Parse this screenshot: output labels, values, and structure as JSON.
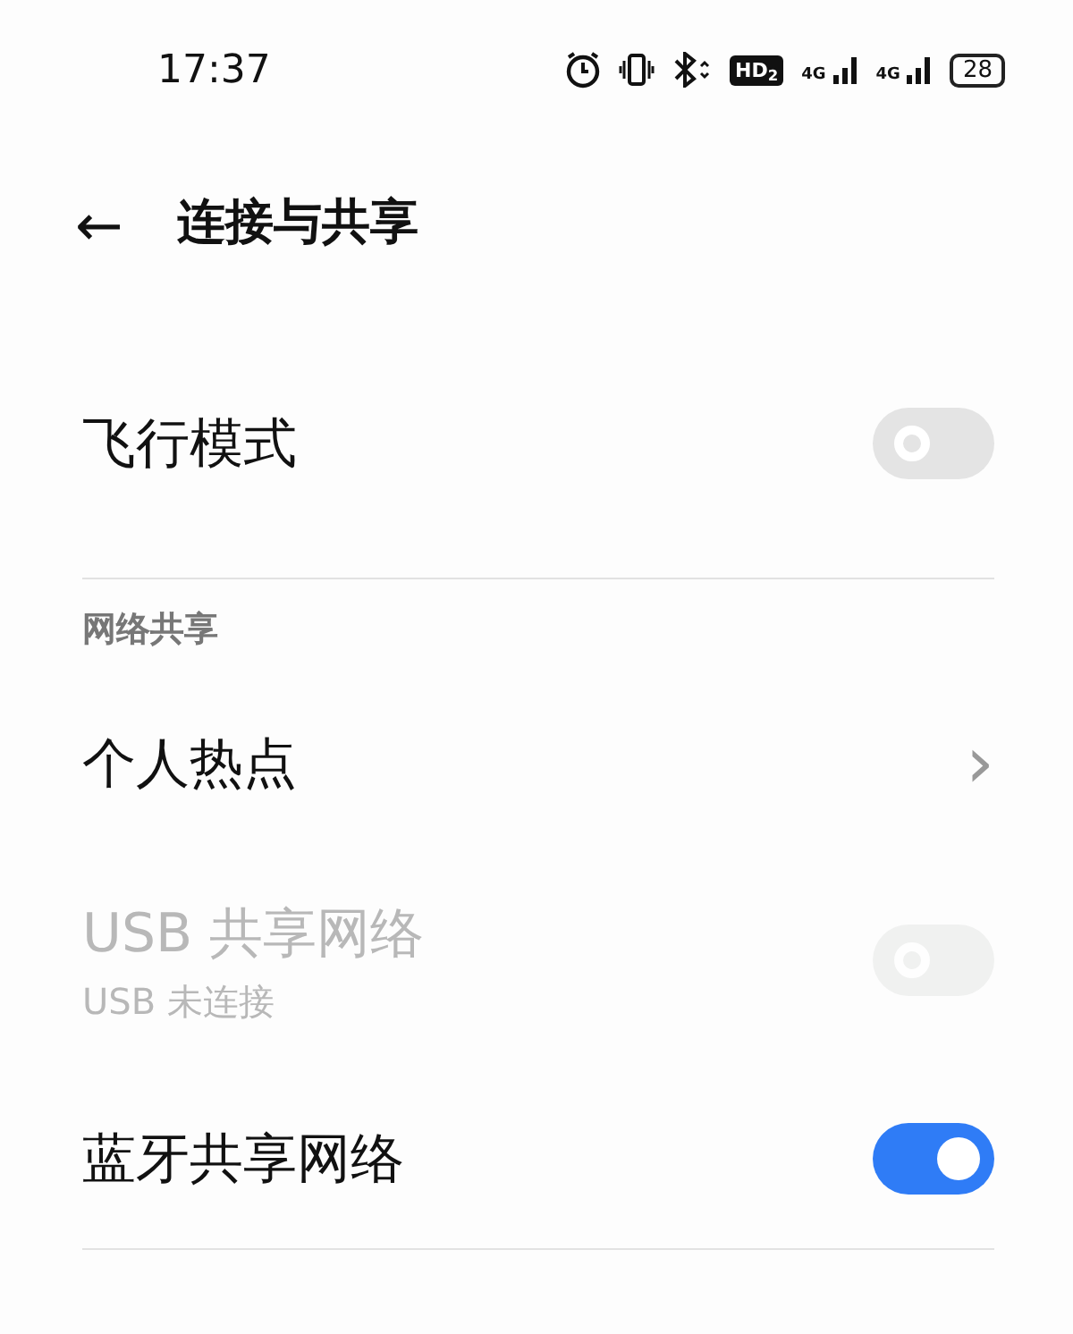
{
  "status_bar": {
    "time": "17:37",
    "hd_badge": "HD$_{2}$",
    "signals": [
      {
        "label": "4G"
      },
      {
        "label": "4G"
      }
    ],
    "battery": "28"
  },
  "header": {
    "back": "←",
    "title": "连接与共享"
  },
  "items": [
    {
      "kind": "toggle",
      "label": "飞行模式",
      "on": false,
      "disabled": false
    },
    {
      "kind": "divider"
    },
    {
      "kind": "section",
      "label": "网络共享"
    },
    {
      "kind": "link",
      "label": "个人热点",
      "chevron": "›"
    },
    {
      "kind": "toggle",
      "label": "USB 共享网络",
      "sublabel": "USB 未连接",
      "on": false,
      "disabled": true
    },
    {
      "kind": "toggle",
      "label": "蓝牙共享网络",
      "on": true,
      "disabled": false
    },
    {
      "kind": "divider"
    }
  ]
}
